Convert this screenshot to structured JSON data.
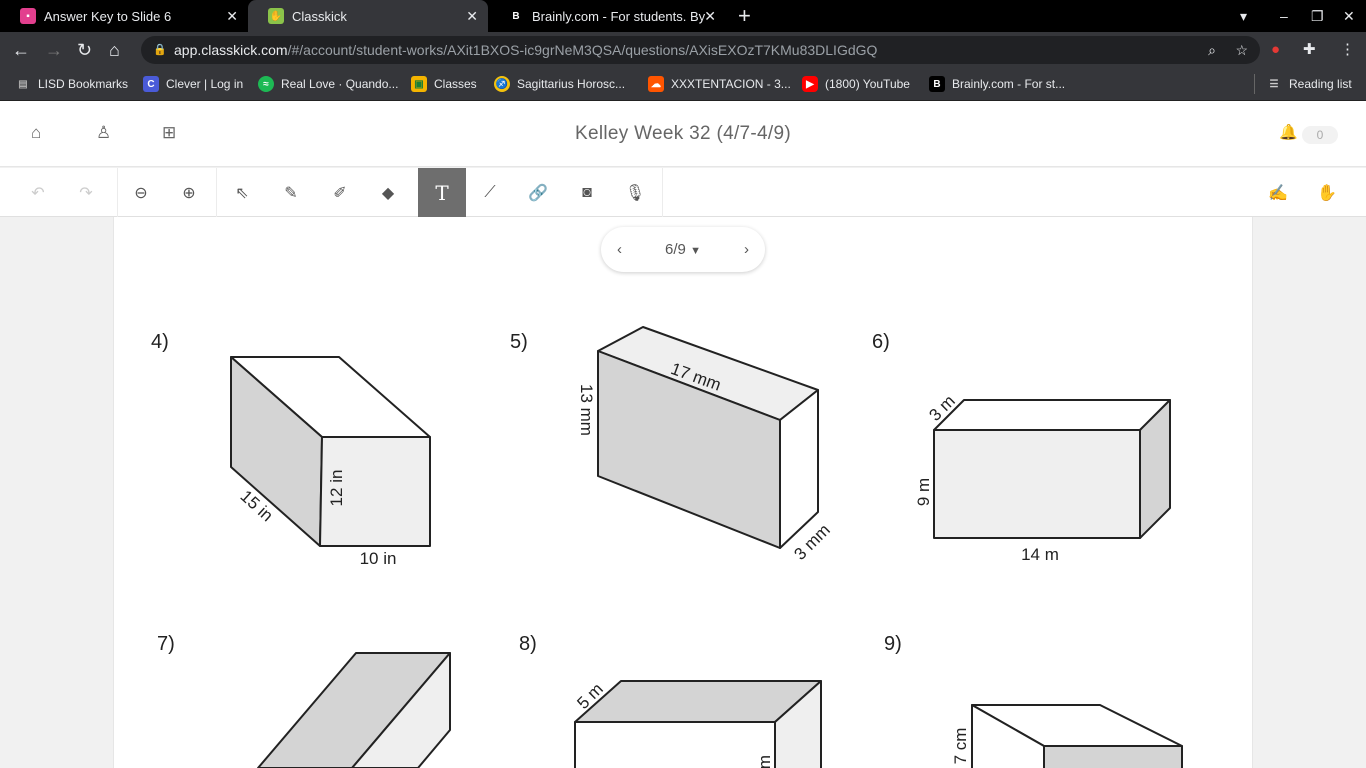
{
  "browser": {
    "tabs": [
      {
        "title": "Answer Key to Slide 6"
      },
      {
        "title": "Classkick"
      },
      {
        "title": "Brainly.com - For students. By students."
      }
    ],
    "new_tab": "+",
    "url_host": "app.classkick.com",
    "url_path": "/#/account/student-works/AXit1BXOS-ic9grNeM3QSA/questions/AXisEXOzT7KMu83DLIGdGQ",
    "bookmarks": [
      "LISD Bookmarks",
      "Clever | Log in",
      "Real Love · Quando...",
      "Classes",
      "Sagittarius Horosc...",
      "XXXTENTACION - 3...",
      "(1800) YouTube",
      "Brainly.com - For st..."
    ],
    "reading_list": "Reading list"
  },
  "app": {
    "title": "Kelley Week 32 (4/7-4/9)",
    "notification_count": "0"
  },
  "pager": {
    "current": "6/9"
  },
  "colors": {
    "active_tool": "#6e6e6e",
    "shade": "#d4d4d4",
    "light": "#efefef"
  },
  "problems": [
    {
      "number": "4)",
      "labels": [
        "15 in",
        "12 in",
        "10 in"
      ]
    },
    {
      "number": "5)",
      "labels": [
        "17 mm",
        "13 mm",
        "3 mm"
      ]
    },
    {
      "number": "6)",
      "labels": [
        "3 m",
        "9 m",
        "14 m"
      ]
    },
    {
      "number": "7)",
      "labels": []
    },
    {
      "number": "8)",
      "labels": [
        "5 m",
        "m"
      ]
    },
    {
      "number": "9)",
      "labels": [
        "7 cm"
      ]
    }
  ]
}
